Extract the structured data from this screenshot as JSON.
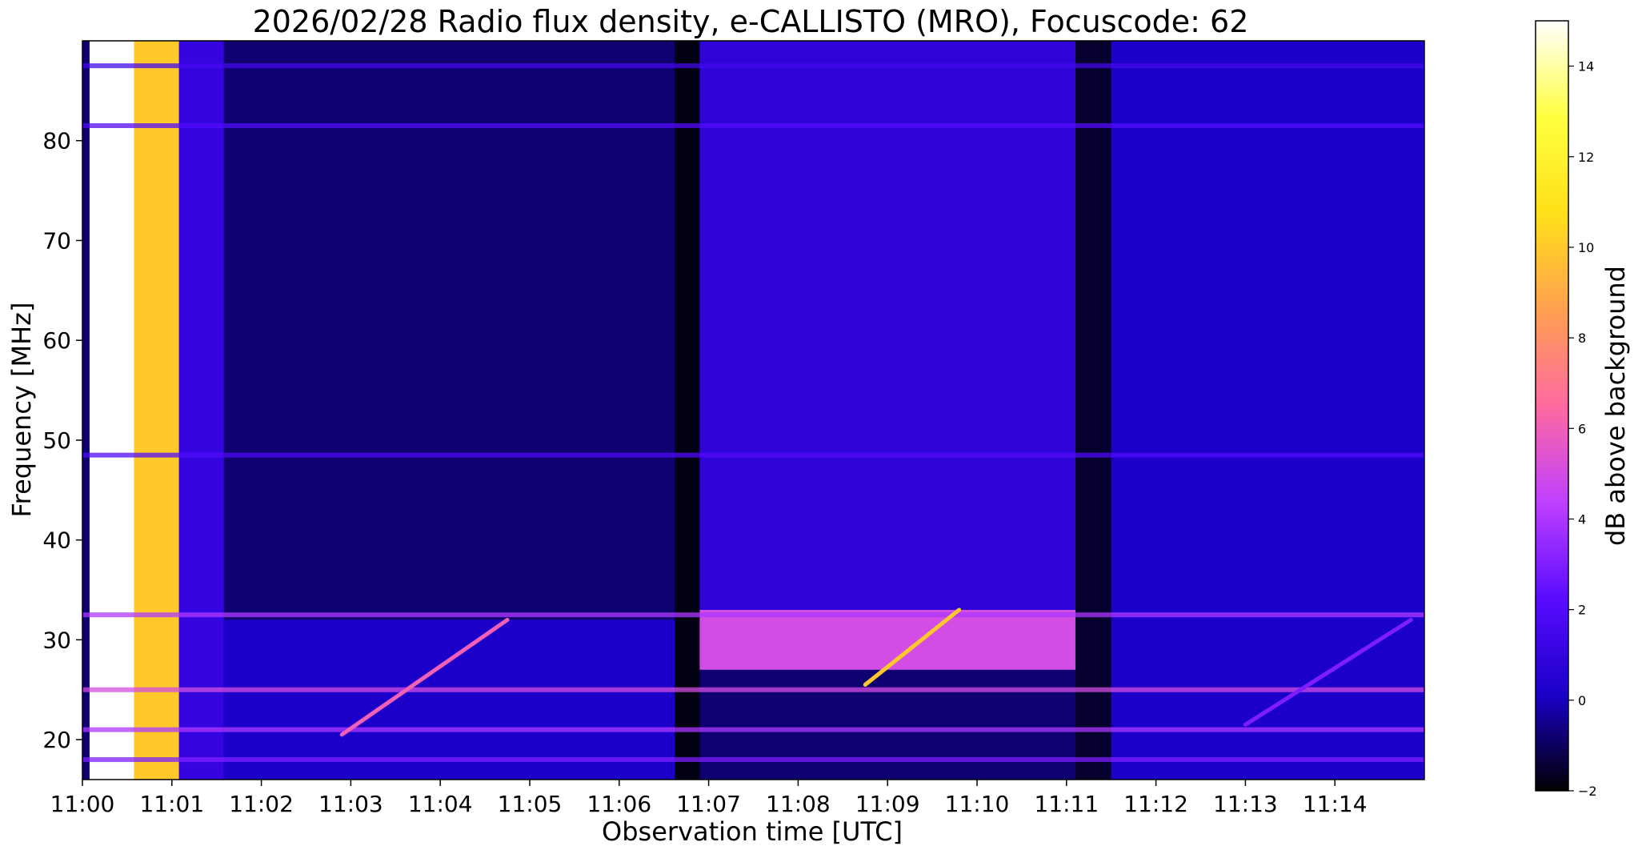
{
  "chart_data": {
    "type": "heatmap",
    "title": "2026/02/28  Radio flux density, e-CALLISTO (MRO), Focuscode: 62",
    "xlabel": "Observation time [UTC]",
    "ylabel": "Frequency [MHz]",
    "x_tick_labels": [
      "11:00",
      "11:01",
      "11:02",
      "11:03",
      "11:04",
      "11:05",
      "11:06",
      "11:07",
      "11:08",
      "11:09",
      "11:10",
      "11:11",
      "11:12",
      "11:13",
      "11:14"
    ],
    "x_start_minute": 0,
    "x_end_minute": 15,
    "y_ticks": [
      20,
      30,
      40,
      50,
      60,
      70,
      80
    ],
    "ylim": [
      16,
      90
    ],
    "colorbar": {
      "label": "dB above background",
      "ticks": [
        -2,
        0,
        2,
        4,
        6,
        8,
        10,
        12,
        14
      ],
      "range": [
        -2,
        15
      ],
      "colormap": [
        "#000000",
        "#1a00c8",
        "#5a0cff",
        "#c040ff",
        "#ff6aa0",
        "#ffa050",
        "#ffe018",
        "#ffff40",
        "#ffffff"
      ]
    },
    "regions": [
      {
        "t0": 0.08,
        "t1": 0.58,
        "f0": 16,
        "f1": 90,
        "db": 15
      },
      {
        "t0": 0.58,
        "t1": 1.08,
        "f0": 16,
        "f1": 90,
        "db": 10
      },
      {
        "t0": 1.08,
        "t1": 1.58,
        "f0": 16,
        "f1": 90,
        "db": 1
      },
      {
        "t0": 1.58,
        "t1": 6.62,
        "f0": 16,
        "f1": 32,
        "db": 0.2
      },
      {
        "t0": 6.62,
        "t1": 6.9,
        "f0": 16,
        "f1": 90,
        "db": -1.8
      },
      {
        "t0": 6.9,
        "t1": 11.1,
        "f0": 27,
        "f1": 33,
        "db": 5
      },
      {
        "t0": 6.9,
        "t1": 11.1,
        "f0": 33,
        "f1": 90,
        "db": 0.8
      },
      {
        "t0": 11.1,
        "t1": 11.5,
        "f0": 16,
        "f1": 90,
        "db": -1.5
      },
      {
        "t0": 11.5,
        "t1": 15,
        "f0": 16,
        "f1": 90,
        "db": 0.2
      }
    ],
    "bursts": [
      {
        "t0": 2.9,
        "f0": 20.5,
        "t1": 4.75,
        "f1": 32,
        "db": 6
      },
      {
        "t0": 8.75,
        "f0": 25.5,
        "t1": 9.8,
        "f1": 33,
        "db": 10
      },
      {
        "t0": 13.0,
        "f0": 21.5,
        "t1": 14.85,
        "f1": 32,
        "db": 3
      }
    ],
    "bands": [
      {
        "f": 18,
        "db": 3
      },
      {
        "f": 21,
        "db": 4
      },
      {
        "f": 25,
        "db": 5
      },
      {
        "f": 32.5,
        "db": 4
      },
      {
        "f": 48.5,
        "db": 2
      },
      {
        "f": 81.5,
        "db": 2
      },
      {
        "f": 87.5,
        "db": 1.5
      }
    ]
  }
}
